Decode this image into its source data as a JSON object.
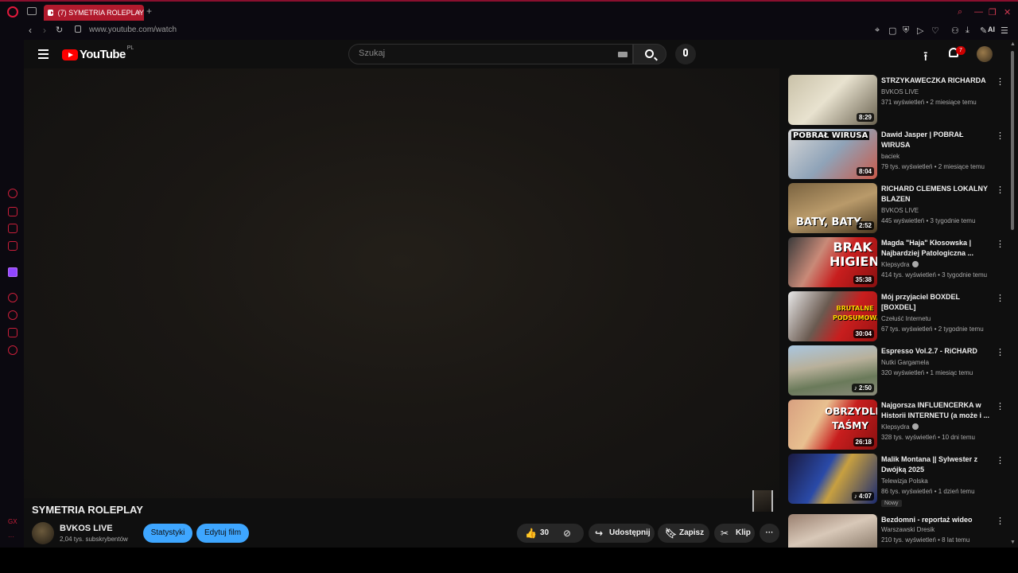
{
  "browser": {
    "tab_title": "(7) SYMETRIA ROLEPLAY",
    "url": "www.youtube.com/watch",
    "ai_label": "AI"
  },
  "masthead": {
    "logo_text": "YouTube",
    "region": "PL",
    "search_placeholder": "Szukaj",
    "notification_count": "7"
  },
  "video": {
    "title": "SYMETRIA ROLEPLAY",
    "channel": "BVKOS LIVE",
    "subscribers": "2,04 tys. subskrybentów",
    "stats_button": "Statystyki",
    "edit_button": "Edytuj film",
    "likes": "30",
    "share": "Udostępnij",
    "save": "Zapisz",
    "clip": "Klip"
  },
  "related": [
    {
      "title": "STRZYKAWECZKA RICHARDA",
      "channel": "BVKOS LIVE",
      "meta": "371 wyświetleń • 2 miesiące temu",
      "duration": "8:29",
      "verified": false
    },
    {
      "title": "Dawid Jasper | POBRAŁ WIRUSA",
      "channel": "baciek",
      "meta": "79 tys. wyświetleń • 2 miesiące temu",
      "duration": "8:04",
      "overlay": "POBRAŁ WIRUSA",
      "verified": false
    },
    {
      "title": "RICHARD CLEMENS LOKALNY BLAZEN",
      "channel": "BVKOS LIVE",
      "meta": "445 wyświetleń • 3 tygodnie temu",
      "duration": "2:52",
      "overlay": "BATY, BATY",
      "verified": false
    },
    {
      "title": "Magda \"Haja\" Kłosowska | Najbardziej Patologiczna ...",
      "channel": "Klepsydra",
      "meta": "414 tys. wyświetleń • 3 tygodnie temu",
      "duration": "35:38",
      "overlay": "BRAK HIGIENY",
      "verified": true
    },
    {
      "title": "Mój przyjaciel BOXDEL [BOXDEL]",
      "channel": "Czełuść Internetu",
      "meta": "67 tys. wyświetleń • 2 tygodnie temu",
      "duration": "30:04",
      "overlay": "BRUTALNE PODSUMOWANIE",
      "verified": false
    },
    {
      "title": "Espresso Vol.2.7 - RiCHARD",
      "channel": "Nutki Gargamela",
      "meta": "320 wyświetleń • 1 miesiąc temu",
      "duration": "2:50",
      "verified": false
    },
    {
      "title": "Najgorsza INFLUENCERKA w Historii INTERNETU (a może i ...",
      "channel": "Klepsydra",
      "meta": "328 tys. wyświetleń • 10 dni temu",
      "duration": "26:18",
      "overlay": "OBRZYDLIWE TAŚMY",
      "verified": true
    },
    {
      "title": "Malik Montana || Sylwester z Dwójką 2025",
      "channel": "Telewizja Polska",
      "meta": "86 tys. wyświetleń • 1 dzień temu",
      "duration": "4:07",
      "badge": "Nowy",
      "verified": false
    },
    {
      "title": "Bezdomni - reportaż wideo",
      "channel": "Warszawski Dresik",
      "meta": "210 tys. wyświetleń • 8 lat temu",
      "verified": false
    }
  ]
}
